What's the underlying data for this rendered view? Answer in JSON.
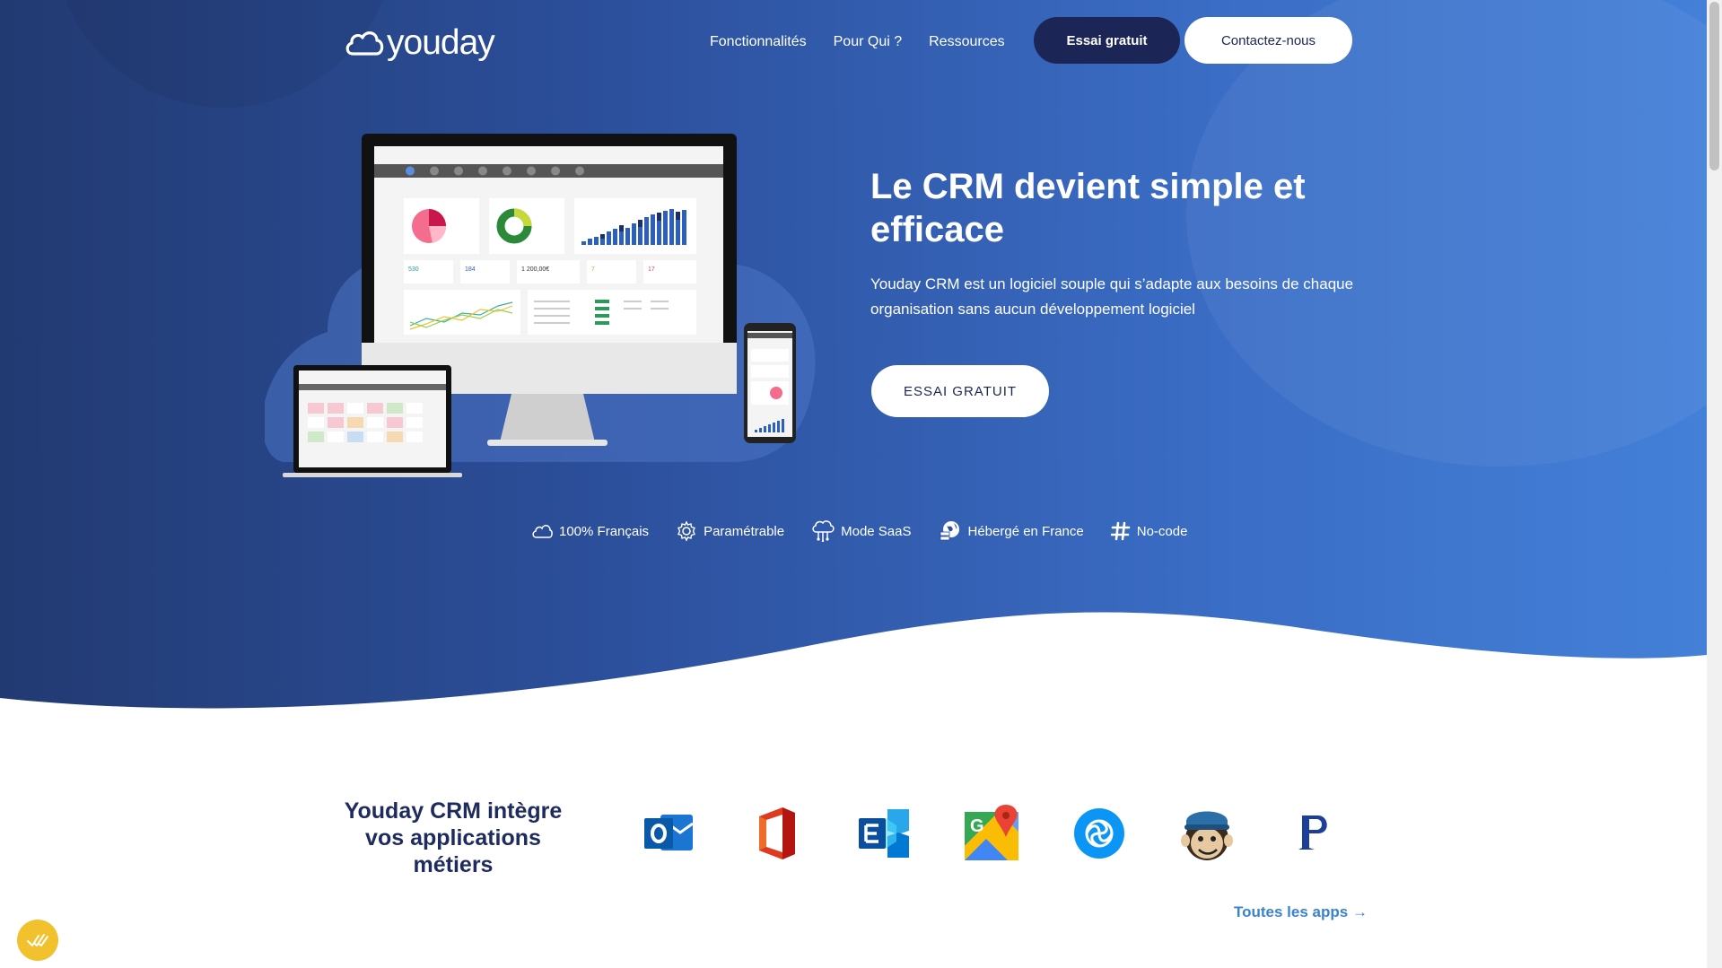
{
  "header": {
    "logo_text": "youday",
    "nav": [
      "Fonctionnalités",
      "Pour Qui ?",
      "Ressources"
    ],
    "trial_button": "Essai gratuit",
    "contact_button": "Contactez-nous"
  },
  "hero": {
    "title": "Le CRM devient simple et efficace",
    "subtitle": "Youday CRM est un logiciel souple qui s’adapte aux besoins de chaque organisation sans aucun développement logiciel",
    "cta": "ESSAI GRATUIT"
  },
  "features": [
    {
      "label": "100% Français",
      "icon": "cloud-icon"
    },
    {
      "label": "Paramétrable",
      "icon": "gear-icon"
    },
    {
      "label": "Mode SaaS",
      "icon": "cloud-network-icon"
    },
    {
      "label": "Hébergé en France",
      "icon": "globe-server-icon"
    },
    {
      "label": "No-code",
      "icon": "hashtag-icon"
    }
  ],
  "dashboard_stats": [
    "530",
    "184",
    "1 200,00€",
    "7",
    "17"
  ],
  "integrations": {
    "title": "Youday CRM intègre vos applications métiers",
    "apps": [
      "outlook-icon",
      "office-icon",
      "exchange-icon",
      "google-maps-icon",
      "sendinblue-icon",
      "mailchimp-icon",
      "pennylane-icon"
    ],
    "all_apps_link": "Toutes les apps →"
  },
  "colors": {
    "dark_navy": "#1b2656",
    "hero_gradient_start": "#223a72",
    "hero_gradient_end": "#4480d8",
    "link_blue": "#3a82d2",
    "badge_yellow": "#f2c12e"
  }
}
